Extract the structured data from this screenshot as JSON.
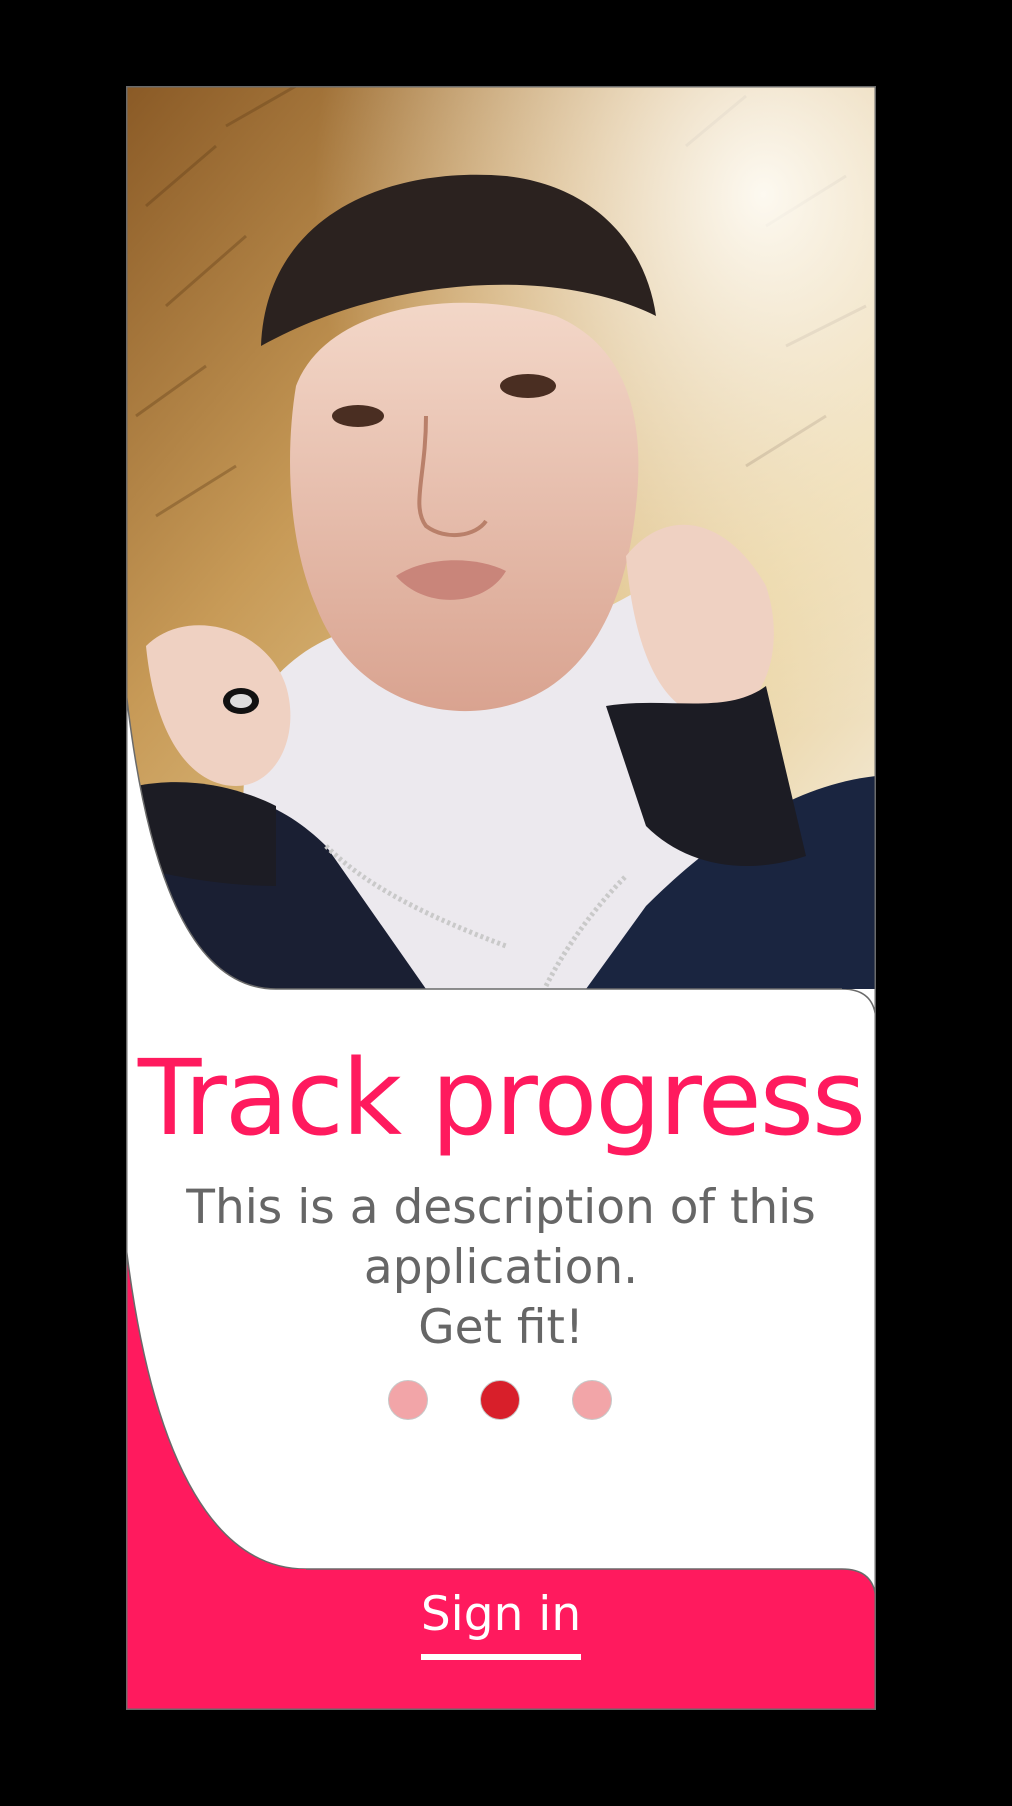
{
  "onboarding": {
    "title": "Track progress",
    "description_lines": [
      "This is a description of this",
      "application.",
      "Get fit!"
    ],
    "pagination": {
      "total": 3,
      "active_index": 2
    },
    "sign_in_label": "Sign in"
  },
  "colors": {
    "accent": "#ff1a5e",
    "title_text": "#ff1a5e",
    "description_text": "#666666",
    "dot_inactive": "#f2a5a8",
    "dot_active": "#d81f2a",
    "sign_in_text": "#ffffff",
    "background": "#ffffff",
    "outline": "#6a6a6a"
  },
  "images": {
    "hero_photo": "portrait of a person wearing a fur-trimmed winter hood"
  }
}
